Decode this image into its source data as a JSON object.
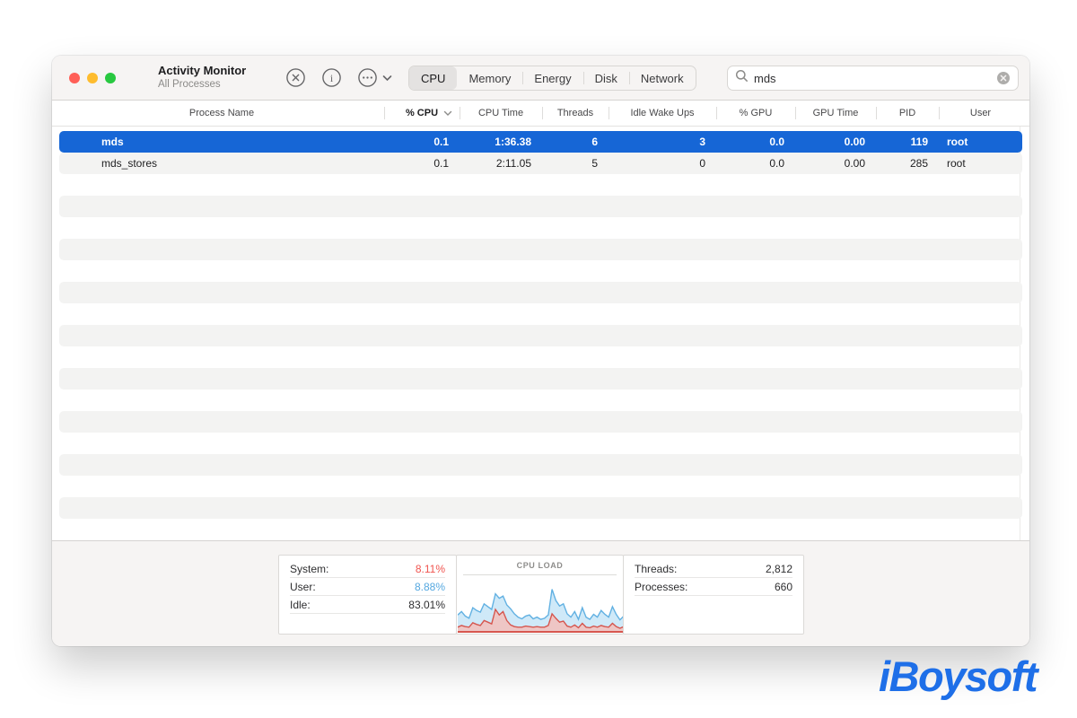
{
  "window": {
    "title": "Activity Monitor",
    "subtitle": "All Processes",
    "traffic_lights": {
      "close": "#ff5f57",
      "minimize": "#febc2e",
      "zoom": "#28c840"
    },
    "toolbar": {
      "quit_process": "x-circle",
      "inspect": "info-circle",
      "more_options": "ellipsis-circle",
      "more_chevron": "chevron-down"
    },
    "tabs": [
      {
        "label": "CPU",
        "selected": true
      },
      {
        "label": "Memory",
        "selected": false
      },
      {
        "label": "Energy",
        "selected": false
      },
      {
        "label": "Disk",
        "selected": false
      },
      {
        "label": "Network",
        "selected": false
      }
    ],
    "search": {
      "value": "mds",
      "icon": "magnifier",
      "clear_icon": "x-clear"
    }
  },
  "table": {
    "columns": [
      {
        "label": "Process Name",
        "sorted": false
      },
      {
        "label": "% CPU",
        "sorted": true,
        "sort_direction": "desc"
      },
      {
        "label": "CPU Time",
        "sorted": false
      },
      {
        "label": "Threads",
        "sorted": false
      },
      {
        "label": "Idle Wake Ups",
        "sorted": false
      },
      {
        "label": "% GPU",
        "sorted": false
      },
      {
        "label": "GPU Time",
        "sorted": false
      },
      {
        "label": "PID",
        "sorted": false
      },
      {
        "label": "User",
        "sorted": false
      }
    ],
    "rows": [
      {
        "name": "mds",
        "cpu": "0.1",
        "cpu_time": "1:36.38",
        "threads": "6",
        "idle_wake_ups": "3",
        "gpu": "0.0",
        "gpu_time": "0.00",
        "pid": "119",
        "user": "root",
        "selected": true
      },
      {
        "name": "mds_stores",
        "cpu": "0.1",
        "cpu_time": "2:11.05",
        "threads": "5",
        "idle_wake_ups": "0",
        "gpu": "0.0",
        "gpu_time": "0.00",
        "pid": "285",
        "user": "root",
        "selected": false
      }
    ],
    "empty_row_count": 17
  },
  "footer": {
    "cpu_stats": [
      {
        "label": "System:",
        "value": "8.11%",
        "color": "#f0544f"
      },
      {
        "label": "User:",
        "value": "8.88%",
        "color": "#55a8e0"
      },
      {
        "label": "Idle:",
        "value": "83.01%",
        "color": "#2e2e30"
      }
    ],
    "load_title": "CPU LOAD",
    "counts": [
      {
        "label": "Threads:",
        "value": "2,812"
      },
      {
        "label": "Processes:",
        "value": "660"
      }
    ]
  },
  "chart_data": {
    "type": "area",
    "title": "CPU LOAD",
    "ylim": [
      0,
      100
    ],
    "legend": "none",
    "series": [
      {
        "name": "user",
        "stroke": "#62b1e2",
        "fill": "#cfe9f8",
        "values": [
          32,
          38,
          30,
          26,
          45,
          40,
          37,
          52,
          47,
          42,
          70,
          62,
          66,
          50,
          43,
          34,
          28,
          25,
          30,
          32,
          25,
          28,
          24,
          26,
          32,
          78,
          58,
          48,
          52,
          34,
          28,
          38,
          24,
          45,
          28,
          24,
          33,
          28,
          40,
          33,
          28,
          47,
          33,
          23,
          30
        ]
      },
      {
        "name": "system",
        "stroke": "#d6564e",
        "fill": "#eec6c5",
        "values": [
          10,
          13,
          11,
          10,
          18,
          15,
          13,
          22,
          19,
          16,
          42,
          32,
          38,
          22,
          14,
          11,
          10,
          10,
          12,
          11,
          10,
          11,
          10,
          10,
          13,
          34,
          26,
          19,
          21,
          12,
          10,
          14,
          9,
          17,
          10,
          9,
          12,
          10,
          13,
          11,
          10,
          17,
          11,
          8,
          11
        ]
      }
    ]
  },
  "watermark": {
    "text": "iBoysoft",
    "color": "#1e6fe8"
  },
  "colors": {
    "selection": "#1666d6",
    "row_stripe": "#f3f3f2",
    "titlebar": "#f6f4f3"
  }
}
